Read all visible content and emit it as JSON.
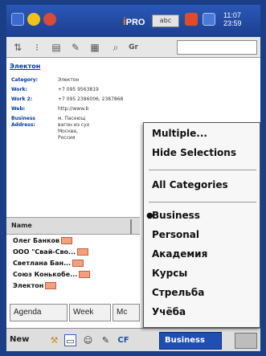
{
  "status_bar": {
    "brand": "PRO",
    "brand_prefix": "i",
    "lang_indicator": "abc",
    "clock_line1": "11:07",
    "clock_line2": "23:59"
  },
  "contact": {
    "name": "Электон",
    "fields": [
      {
        "label": "Category:",
        "value": "Электон"
      },
      {
        "label": "Work:",
        "value": "+7 095 9563819"
      },
      {
        "label": "Work 2:",
        "value": "+7 095 2386006, 2387868"
      },
      {
        "label": "Web:",
        "value": "http://www.b"
      },
      {
        "label": "Business",
        "value": "м. Пасеющ"
      },
      {
        "label": "Address:",
        "value": "вагон из сух"
      },
      {
        "label": "",
        "value": "Москва,"
      },
      {
        "label": "",
        "value": "Россия"
      }
    ]
  },
  "list": {
    "header": "Name",
    "items": [
      {
        "label": "Олег Банков"
      },
      {
        "label": "ООО \"Свай-Сво..."
      },
      {
        "label": "Светлана Бан..."
      },
      {
        "label": "Союз Конькобе..."
      },
      {
        "label": "Электон"
      }
    ]
  },
  "tabs": [
    {
      "label": "Agenda"
    },
    {
      "label": "Week"
    },
    {
      "label": "Mc"
    }
  ],
  "bottom_bar": {
    "new_label": "New",
    "category_label": "Business",
    "cf_label": "CF"
  },
  "menu": {
    "items": [
      {
        "label": "Multiple..."
      },
      {
        "label": "Hide Selections"
      },
      {
        "label": "All Categories"
      },
      {
        "label": "Business",
        "selected": true
      },
      {
        "label": "Personal"
      },
      {
        "label": "Академия"
      },
      {
        "label": "Курсы"
      },
      {
        "label": "Стрельба"
      },
      {
        "label": "Учёба"
      }
    ]
  },
  "colors": {
    "outer_background": "#1a3f86",
    "status_bar": "#2a58b8",
    "link_blue": "#0030c0",
    "category_swatch": "#f4a07c",
    "category_button": "#1f4fb4"
  }
}
